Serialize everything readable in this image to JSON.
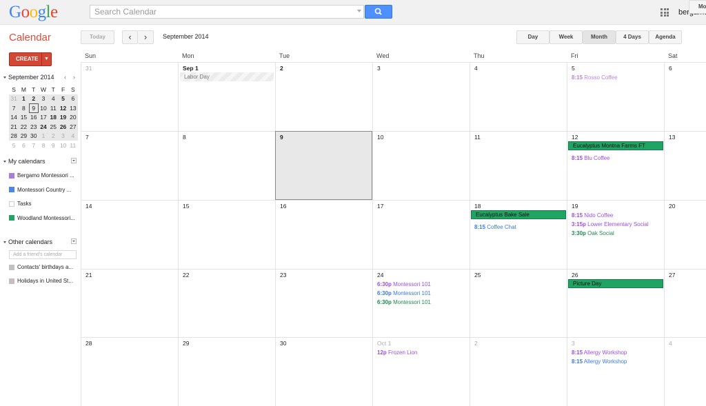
{
  "header": {
    "logo": "Google",
    "search_placeholder": "Search Calendar",
    "user": "bergamoschool",
    "apps_icon": "apps-grid-icon",
    "search_icon": "magnifier-icon"
  },
  "app": {
    "title": "Calendar"
  },
  "toolbar": {
    "today": "Today",
    "prev": "‹",
    "next": "›",
    "current_period": "September 2014",
    "views": [
      {
        "label": "Day"
      },
      {
        "label": "Week"
      },
      {
        "label": "Month",
        "active": true
      },
      {
        "label": "4 Days"
      },
      {
        "label": "Agenda"
      }
    ],
    "more": "More"
  },
  "sidebar": {
    "create": "CREATE",
    "mini_calendar": {
      "title": "September 2014",
      "prev": "‹",
      "next": "›",
      "weekdays": [
        "S",
        "M",
        "T",
        "W",
        "T",
        "F",
        "S"
      ],
      "weeks": [
        [
          "31",
          "1",
          "2",
          "3",
          "4",
          "5",
          "6"
        ],
        [
          "7",
          "8",
          "9",
          "10",
          "11",
          "12",
          "13"
        ],
        [
          "14",
          "15",
          "16",
          "17",
          "18",
          "19",
          "20"
        ],
        [
          "21",
          "22",
          "23",
          "24",
          "25",
          "26",
          "27"
        ],
        [
          "28",
          "29",
          "30",
          "1",
          "2",
          "3",
          "4"
        ],
        [
          "5",
          "6",
          "7",
          "8",
          "9",
          "10",
          "11"
        ]
      ],
      "selected": "9"
    },
    "my_calendars": {
      "title": "My calendars",
      "items": [
        {
          "label": "Bergamo Montessori ...",
          "color": "#a77ee0"
        },
        {
          "label": "Montessori Country ...",
          "color": "#4986e7"
        },
        {
          "label": "Tasks",
          "color": "#ffffff"
        },
        {
          "label": "Woodland Montessori...",
          "color": "#1fa463"
        }
      ]
    },
    "other_calendars": {
      "title": "Other calendars",
      "add_placeholder": "Add a friend's calendar",
      "items": [
        {
          "label": "Contacts' birthdays a...",
          "color": "#c2c2c2"
        },
        {
          "label": "Holidays in United St...",
          "color": "#cabdbf"
        }
      ]
    }
  },
  "month": {
    "weekdays": [
      "Sun",
      "Mon",
      "Tue",
      "Wed",
      "Thu",
      "Fri",
      "Sat"
    ],
    "weeks": [
      [
        {
          "d": "31",
          "other": true
        },
        {
          "d": "Sep 1",
          "bold": true,
          "holiday": "Labor Day"
        },
        {
          "d": "2",
          "bold": true
        },
        {
          "d": "3"
        },
        {
          "d": "4"
        },
        {
          "d": "5",
          "events": [
            {
              "time": "8:15",
              "title": "Rosso Coffee",
              "color": "#b983e8"
            }
          ]
        },
        {
          "d": "6"
        }
      ],
      [
        {
          "d": "7"
        },
        {
          "d": "8"
        },
        {
          "d": "9",
          "today": true,
          "bold": true
        },
        {
          "d": "10"
        },
        {
          "d": "11"
        },
        {
          "d": "12",
          "allday": "Eucalyptus Montna Farms FT",
          "events": [
            {
              "time": "8:15",
              "title": "Blu Coffee",
              "color": "#9a4ee8"
            }
          ]
        },
        {
          "d": "13"
        }
      ],
      [
        {
          "d": "14"
        },
        {
          "d": "15"
        },
        {
          "d": "16"
        },
        {
          "d": "17"
        },
        {
          "d": "18",
          "allday": "Eucalyptus Bake Sale",
          "events": [
            {
              "time": "8:15",
              "title": "Coffee Chat",
              "color": "#3b78e7"
            }
          ]
        },
        {
          "d": "19",
          "events": [
            {
              "time": "8:15",
              "title": "Nido Coffee",
              "color": "#9a4ee8"
            },
            {
              "time": "3:15p",
              "title": "Lower Elementary Social",
              "color": "#9a4ee8"
            },
            {
              "time": "3:30p",
              "title": "Oak Social",
              "color": "#1b8a4f"
            }
          ]
        },
        {
          "d": "20"
        }
      ],
      [
        {
          "d": "21"
        },
        {
          "d": "22"
        },
        {
          "d": "23"
        },
        {
          "d": "24",
          "events": [
            {
              "time": "6:30p",
              "title": "Montessori 101",
              "color": "#9a4ee8"
            },
            {
              "time": "6:30p",
              "title": "Montessori 101",
              "color": "#3b78e7"
            },
            {
              "time": "6:30p",
              "title": "Montessori 101",
              "color": "#1b8a4f"
            }
          ]
        },
        {
          "d": "25"
        },
        {
          "d": "26",
          "allday": "Picture Day"
        },
        {
          "d": "27"
        }
      ],
      [
        {
          "d": "28"
        },
        {
          "d": "29"
        },
        {
          "d": "30"
        },
        {
          "d": "Oct 1",
          "other": true,
          "events": [
            {
              "time": "12p",
              "title": "Frozen Lion",
              "color": "#9a4ee8"
            }
          ]
        },
        {
          "d": "2",
          "other": true
        },
        {
          "d": "3",
          "other": true,
          "events": [
            {
              "time": "8:15",
              "title": "Allergy Workshop",
              "color": "#9a4ee8"
            },
            {
              "time": "8:15",
              "title": "Allergy Workshop",
              "color": "#3b78e7"
            }
          ]
        },
        {
          "d": "4",
          "other": true
        }
      ]
    ]
  }
}
